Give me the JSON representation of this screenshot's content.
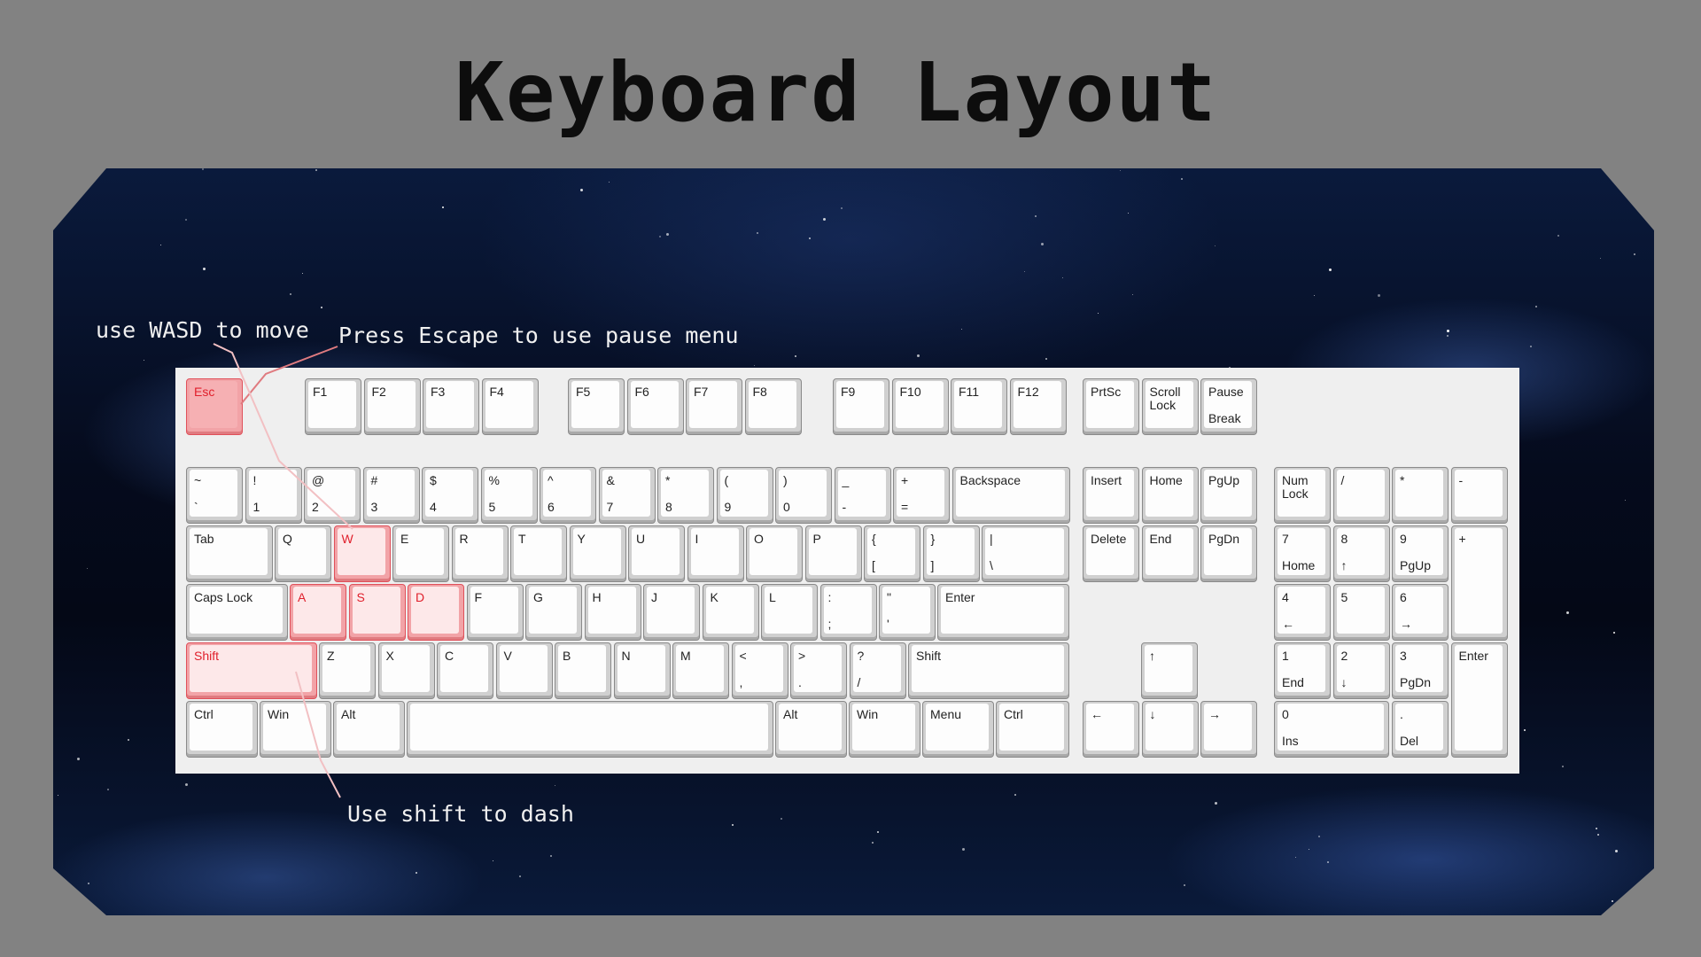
{
  "title": "Keyboard Layout",
  "annotations": {
    "wasd": "use WASD to move",
    "escape": "Press Escape to use pause menu",
    "shift": "Use shift to dash"
  },
  "colors": {
    "background": "#828282",
    "highlight": "#e0202c",
    "key_face": "#fdfdfd",
    "keyboard_plate": "#efefef"
  },
  "keys": [
    {
      "l1": "Esc",
      "l2": "",
      "hl": true
    },
    {
      "l1": "F1",
      "l2": ""
    },
    {
      "l1": "F2",
      "l2": ""
    },
    {
      "l1": "F3",
      "l2": ""
    },
    {
      "l1": "F4",
      "l2": ""
    },
    {
      "l1": "F5",
      "l2": ""
    },
    {
      "l1": "F6",
      "l2": ""
    },
    {
      "l1": "F7",
      "l2": ""
    },
    {
      "l1": "F8",
      "l2": ""
    },
    {
      "l1": "F9",
      "l2": ""
    },
    {
      "l1": "F10",
      "l2": ""
    },
    {
      "l1": "F11",
      "l2": ""
    },
    {
      "l1": "F12",
      "l2": ""
    },
    {
      "l1": "PrtSc",
      "l2": ""
    },
    {
      "l1": "Scroll\nLock",
      "l2": ""
    },
    {
      "l1": "Pause",
      "l2": "Break"
    },
    {
      "l1": "~",
      "l2": "`"
    },
    {
      "l1": "!",
      "l2": "1"
    },
    {
      "l1": "@",
      "l2": "2"
    },
    {
      "l1": "#",
      "l2": "3"
    },
    {
      "l1": "$",
      "l2": "4"
    },
    {
      "l1": "%",
      "l2": "5"
    },
    {
      "l1": "^",
      "l2": "6"
    },
    {
      "l1": "&",
      "l2": "7"
    },
    {
      "l1": "*",
      "l2": "8"
    },
    {
      "l1": "(",
      "l2": "9"
    },
    {
      "l1": ")",
      "l2": "0"
    },
    {
      "l1": "_",
      "l2": "-"
    },
    {
      "l1": "+",
      "l2": "="
    },
    {
      "l1": "Backspace",
      "l2": ""
    },
    {
      "l1": "Insert",
      "l2": ""
    },
    {
      "l1": "Home",
      "l2": ""
    },
    {
      "l1": "PgUp",
      "l2": ""
    },
    {
      "l1": "Num\nLock",
      "l2": ""
    },
    {
      "l1": "/",
      "l2": ""
    },
    {
      "l1": "*",
      "l2": ""
    },
    {
      "l1": "-",
      "l2": ""
    },
    {
      "l1": "Tab",
      "l2": ""
    },
    {
      "l1": "Q",
      "l2": ""
    },
    {
      "l1": "W",
      "l2": "",
      "hl": true
    },
    {
      "l1": "E",
      "l2": ""
    },
    {
      "l1": "R",
      "l2": ""
    },
    {
      "l1": "T",
      "l2": ""
    },
    {
      "l1": "Y",
      "l2": ""
    },
    {
      "l1": "U",
      "l2": ""
    },
    {
      "l1": "I",
      "l2": ""
    },
    {
      "l1": "O",
      "l2": ""
    },
    {
      "l1": "P",
      "l2": ""
    },
    {
      "l1": "{",
      "l2": "["
    },
    {
      "l1": "}",
      "l2": "]"
    },
    {
      "l1": "|",
      "l2": "\\"
    },
    {
      "l1": "Delete",
      "l2": ""
    },
    {
      "l1": "End",
      "l2": ""
    },
    {
      "l1": "PgDn",
      "l2": ""
    },
    {
      "l1": "7",
      "l2": "Home"
    },
    {
      "l1": "8",
      "l2": "↑"
    },
    {
      "l1": "9",
      "l2": "PgUp"
    },
    {
      "l1": "+",
      "l2": ""
    },
    {
      "l1": "Caps Lock",
      "l2": ""
    },
    {
      "l1": "A",
      "l2": "",
      "hl": true
    },
    {
      "l1": "S",
      "l2": "",
      "hl": true
    },
    {
      "l1": "D",
      "l2": "",
      "hl": true
    },
    {
      "l1": "F",
      "l2": ""
    },
    {
      "l1": "G",
      "l2": ""
    },
    {
      "l1": "H",
      "l2": ""
    },
    {
      "l1": "J",
      "l2": ""
    },
    {
      "l1": "K",
      "l2": ""
    },
    {
      "l1": "L",
      "l2": ""
    },
    {
      "l1": ":",
      "l2": ";"
    },
    {
      "l1": "\"",
      "l2": "'"
    },
    {
      "l1": "Enter",
      "l2": ""
    },
    {
      "l1": "4",
      "l2": "←"
    },
    {
      "l1": "5",
      "l2": ""
    },
    {
      "l1": "6",
      "l2": "→"
    },
    {
      "l1": "Shift",
      "l2": "",
      "hl": true
    },
    {
      "l1": "Z",
      "l2": ""
    },
    {
      "l1": "X",
      "l2": ""
    },
    {
      "l1": "C",
      "l2": ""
    },
    {
      "l1": "V",
      "l2": ""
    },
    {
      "l1": "B",
      "l2": ""
    },
    {
      "l1": "N",
      "l2": ""
    },
    {
      "l1": "M",
      "l2": ""
    },
    {
      "l1": "<",
      "l2": ","
    },
    {
      "l1": ">",
      "l2": "."
    },
    {
      "l1": "?",
      "l2": "/"
    },
    {
      "l1": "Shift",
      "l2": ""
    },
    {
      "l1": "↑",
      "l2": ""
    },
    {
      "l1": "1",
      "l2": "End"
    },
    {
      "l1": "2",
      "l2": "↓"
    },
    {
      "l1": "3",
      "l2": "PgDn"
    },
    {
      "l1": "Enter",
      "l2": ""
    },
    {
      "l1": "Ctrl",
      "l2": ""
    },
    {
      "l1": "Win",
      "l2": ""
    },
    {
      "l1": "Alt",
      "l2": ""
    },
    {
      "l1": "",
      "l2": ""
    },
    {
      "l1": "Alt",
      "l2": ""
    },
    {
      "l1": "Win",
      "l2": ""
    },
    {
      "l1": "Menu",
      "l2": ""
    },
    {
      "l1": "Ctrl",
      "l2": ""
    },
    {
      "l1": "←",
      "l2": ""
    },
    {
      "l1": "↓",
      "l2": ""
    },
    {
      "l1": "→",
      "l2": ""
    },
    {
      "l1": "0",
      "l2": "Ins"
    },
    {
      "l1": ".",
      "l2": "Del"
    }
  ]
}
